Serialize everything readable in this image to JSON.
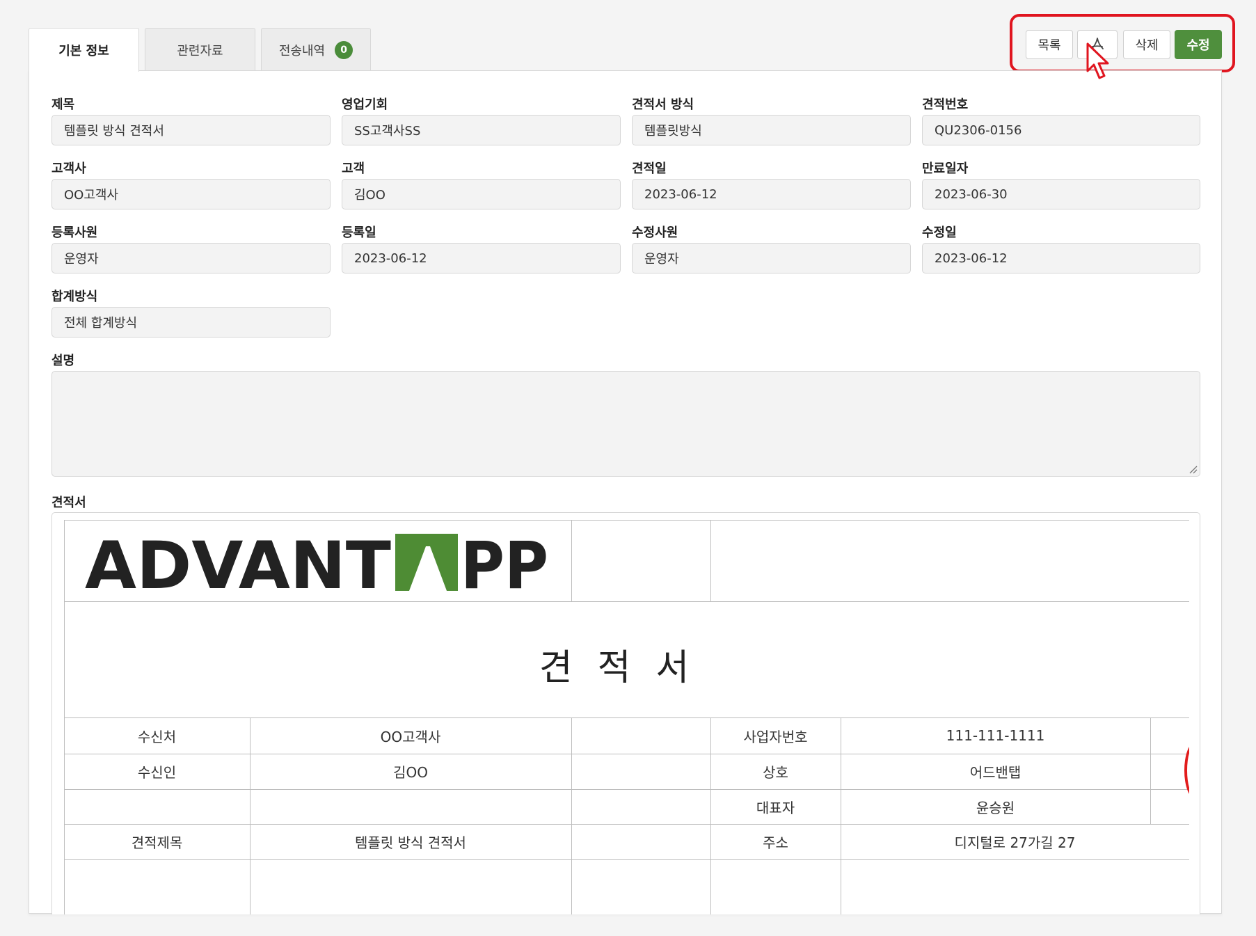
{
  "tabs": [
    {
      "label": "기본 정보"
    },
    {
      "label": "관련자료"
    },
    {
      "label": "전송내역",
      "badge": "0"
    }
  ],
  "actions": {
    "list_label": "목록",
    "pdf_icon": "pdf-icon",
    "delete_label": "삭제",
    "edit_label": "수정"
  },
  "fields": {
    "title": {
      "label": "제목",
      "value": "템플릿 방식 견적서"
    },
    "opportunity": {
      "label": "영업기회",
      "value": "SS고객사SS"
    },
    "quote_method": {
      "label": "견적서 방식",
      "value": "템플릿방식"
    },
    "quote_number": {
      "label": "견적번호",
      "value": "QU2306-0156"
    },
    "customer_company": {
      "label": "고객사",
      "value": "OO고객사"
    },
    "customer": {
      "label": "고객",
      "value": "김OO"
    },
    "quote_date": {
      "label": "견적일",
      "value": "2023-06-12"
    },
    "expiry_date": {
      "label": "만료일자",
      "value": "2023-06-30"
    },
    "registered_by": {
      "label": "등록사원",
      "value": "운영자"
    },
    "registered_date": {
      "label": "등록일",
      "value": "2023-06-12"
    },
    "modified_by": {
      "label": "수정사원",
      "value": "운영자"
    },
    "modified_date": {
      "label": "수정일",
      "value": "2023-06-12"
    },
    "total_method": {
      "label": "합계방식",
      "value": "전체 합계방식"
    },
    "description": {
      "label": "설명",
      "value": ""
    }
  },
  "document": {
    "section_label": "견적서",
    "logo_text": "ADVANTAPP",
    "heading": "견적서",
    "rows": [
      {
        "k1": "수신처",
        "v1": "OO고객사",
        "k2": "사업자번호",
        "v2": "111-111-1111"
      },
      {
        "k1": "수신인",
        "v1": "김OO",
        "k2": "상호",
        "v2": "어드밴탭"
      },
      {
        "k1": "",
        "v1": "",
        "k2": "대표자",
        "v2": "윤승원"
      },
      {
        "k1": "견적제목",
        "v1": "템플릿 방식 견적서",
        "k2": "주소",
        "v2": "디지털로 27가길 27"
      }
    ]
  },
  "colors": {
    "accent": "#4f8f3d",
    "highlight": "#e0151f",
    "logo_dark": "#222222",
    "logo_green": "#4e8c34"
  }
}
